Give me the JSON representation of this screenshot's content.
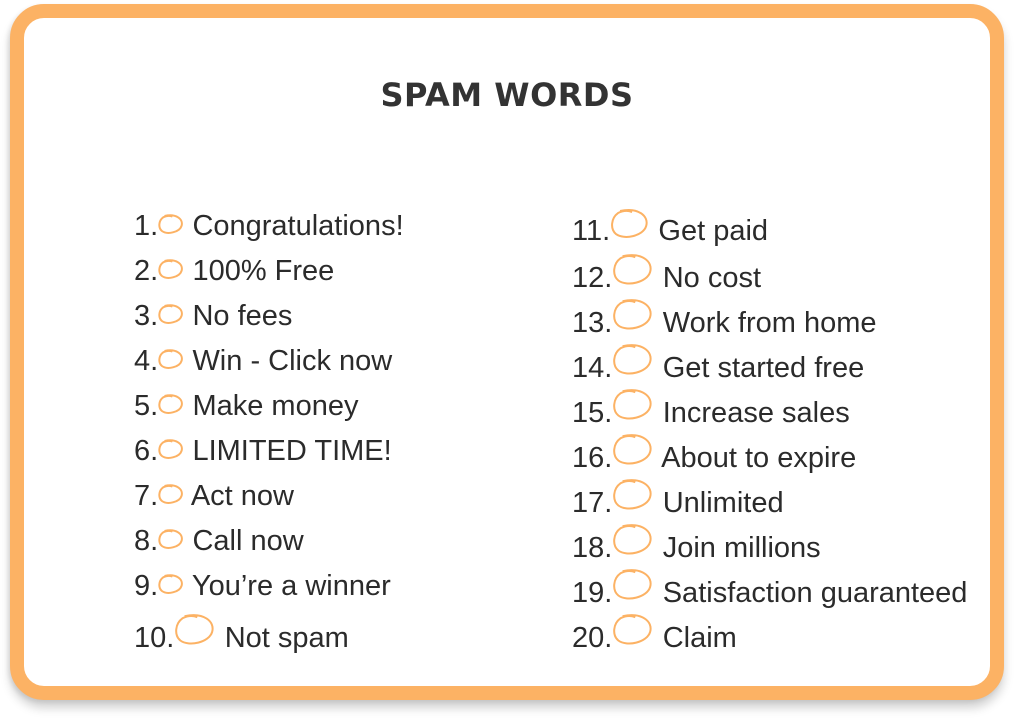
{
  "title": "SPAM WORDS",
  "accent_color": "#fcb264",
  "left_column": [
    {
      "number": "1.",
      "text": "Congratulations!"
    },
    {
      "number": "2.",
      "text": "100% Free"
    },
    {
      "number": "3.",
      "text": "No fees"
    },
    {
      "number": "4.",
      "text": "Win - Click now"
    },
    {
      "number": "5.",
      "text": "Make money"
    },
    {
      "number": "6.",
      "text": "LIMITED TIME!"
    },
    {
      "number": "7.",
      "text": "Act now"
    },
    {
      "number": "8.",
      "text": "Call now"
    },
    {
      "number": "9.",
      "text": "You’re a winner"
    },
    {
      "number": "10.",
      "text": "Not spam"
    }
  ],
  "right_column": [
    {
      "number": "11.",
      "text": "Get paid"
    },
    {
      "number": "12.",
      "text": "No cost"
    },
    {
      "number": "13.",
      "text": "Work from home"
    },
    {
      "number": "14.",
      "text": "Get started free"
    },
    {
      "number": "15.",
      "text": "Increase sales"
    },
    {
      "number": "16.",
      "text": "About to expire"
    },
    {
      "number": "17.",
      "text": "Unlimited"
    },
    {
      "number": "18.",
      "text": "Join millions"
    },
    {
      "number": "19.",
      "text": "Satisfaction guaranteed"
    },
    {
      "number": "20.",
      "text": "Claim"
    }
  ]
}
